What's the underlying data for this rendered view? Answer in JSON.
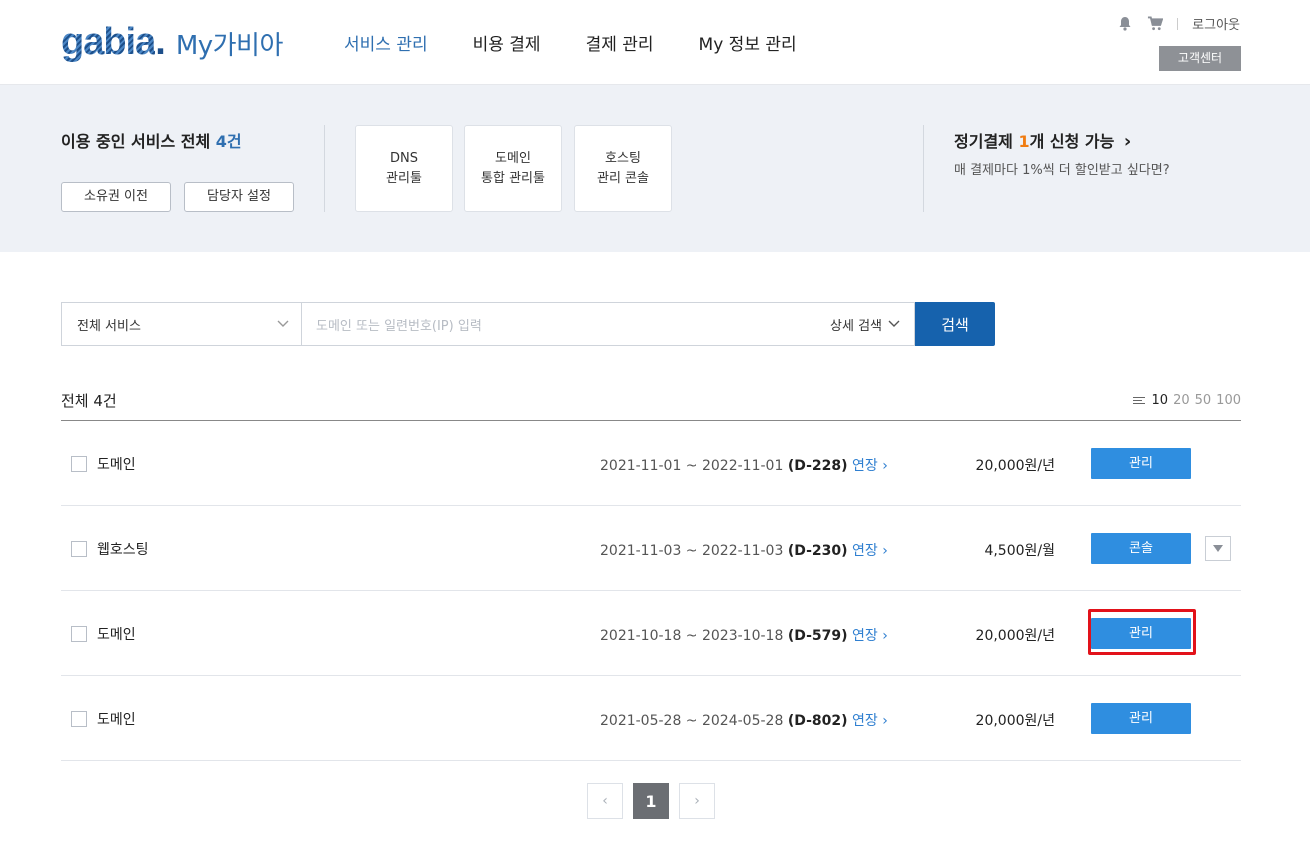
{
  "header": {
    "logo_main": "gabia",
    "logo_dot": ".",
    "logo_sub": "My가비아",
    "nav": [
      "서비스 관리",
      "비용 결제",
      "결제 관리",
      "My 정보 관리"
    ],
    "logout": "로그아웃",
    "customer_center": "고객센터",
    "active_color": "#2f6fb0"
  },
  "summary": {
    "title_prefix": "이용 중인 서비스 전체 ",
    "title_count": "4건",
    "buttons": [
      "소유권 이전",
      "담당자 설정"
    ],
    "tools": [
      {
        "line1": "DNS",
        "line2": "관리툴"
      },
      {
        "line1": "도메인",
        "line2": "통합 관리툴"
      },
      {
        "line1": "호스팅",
        "line2": "관리 콘솔"
      }
    ],
    "promo": {
      "prefix": "정기결제 ",
      "num": "1",
      "suffix": "개 신청 가능",
      "arrow": "›",
      "sub": "매 결제마다 1%씩 더 할인받고 싶다면?"
    }
  },
  "search": {
    "select_value": "전체 서비스",
    "placeholder": "도메인 또는 일련번호(IP) 입력",
    "detail_label": "상세 검색",
    "button_label": "검색"
  },
  "list": {
    "total": "전체 4건",
    "per_page": [
      "10",
      "20",
      "50",
      "100"
    ],
    "rows": [
      {
        "service": "도메인",
        "range": "2021-11-01 ~ 2022-11-01",
        "dday": "(D-228)",
        "extend": "연장 ›",
        "price": "20,000원/년",
        "action": "관리"
      },
      {
        "service": "웹호스팅",
        "range": "2021-11-03 ~ 2022-11-03",
        "dday": "(D-230)",
        "extend": "연장 ›",
        "price": "4,500원/월",
        "action": "콘솔"
      },
      {
        "service": "도메인",
        "range": "2021-10-18 ~ 2023-10-18",
        "dday": "(D-579)",
        "extend": "연장 ›",
        "price": "20,000원/년",
        "action": "관리"
      },
      {
        "service": "도메인",
        "range": "2021-05-28 ~ 2024-05-28",
        "dday": "(D-802)",
        "extend": "연장 ›",
        "price": "20,000원/년",
        "action": "관리"
      }
    ]
  },
  "pagination": {
    "prev": "‹",
    "current": "1",
    "next": "›"
  }
}
